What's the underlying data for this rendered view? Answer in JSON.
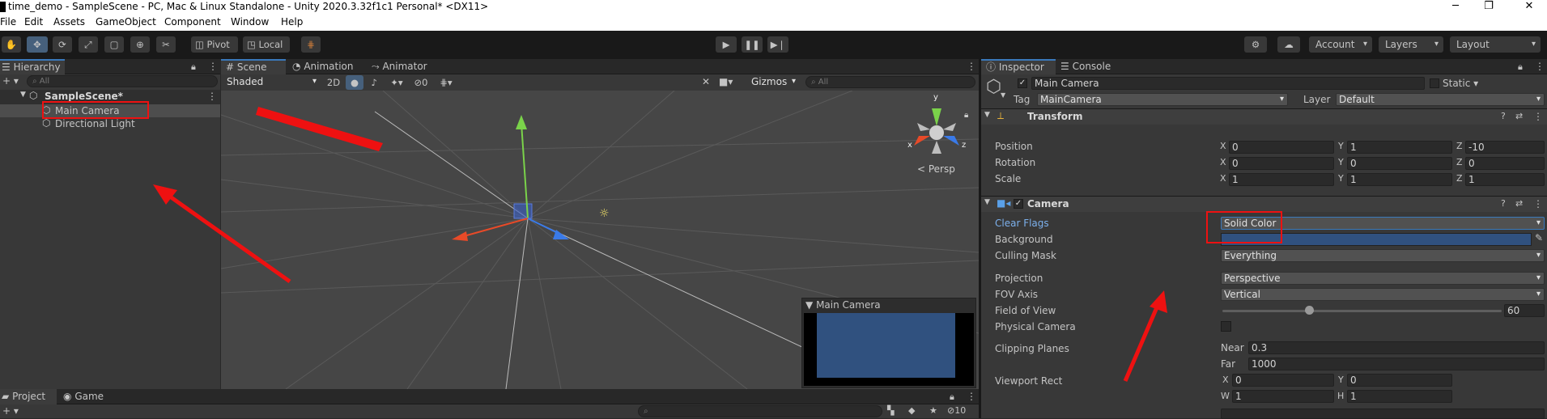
{
  "window": {
    "title": "time_demo - SampleScene - PC, Mac & Linux Standalone - Unity 2020.3.32f1c1 Personal* <DX11>",
    "minimize": "─",
    "maximize": "❐",
    "close": "✕"
  },
  "menu": [
    "File",
    "Edit",
    "Assets",
    "GameObject",
    "Component",
    "Window",
    "Help"
  ],
  "toolbar": {
    "pivot_label": "Pivot",
    "local_label": "Local",
    "account_label": "Account",
    "layers_label": "Layers",
    "layout_label": "Layout"
  },
  "hierarchy": {
    "tab_label": "Hierarchy",
    "add_label": "+ ▾",
    "search_placeholder": "All",
    "scene_name": "SampleScene*",
    "items": [
      "Main Camera",
      "Directional Light"
    ]
  },
  "scene_view": {
    "tabs": [
      "Scene",
      "Animation",
      "Animator"
    ],
    "shading_mode": "Shaded",
    "mode_2d": "2D",
    "hidden_count": "0",
    "gizmos_label": "Gizmos",
    "search_placeholder": "All",
    "persp_label": "< Persp",
    "axis_x": "x",
    "axis_y": "y",
    "axis_z": "z",
    "camera_preview_title": "Main Camera",
    "preview_color": "#30517f"
  },
  "bottom_panel": {
    "tabs": [
      "Project",
      "Game"
    ],
    "add_label": "+ ▾",
    "visible_count": "10"
  },
  "inspector": {
    "tabs": [
      "Inspector",
      "Console"
    ],
    "object_name": "Main Camera",
    "static_label": "Static",
    "tag_label": "Tag",
    "tag_value": "MainCamera",
    "layer_label": "Layer",
    "layer_value": "Default",
    "transform": {
      "title": "Transform",
      "rows": [
        {
          "label": "Position",
          "x": "0",
          "y": "1",
          "z": "-10"
        },
        {
          "label": "Rotation",
          "x": "0",
          "y": "0",
          "z": "0"
        },
        {
          "label": "Scale",
          "x": "1",
          "y": "1",
          "z": "1"
        }
      ]
    },
    "camera": {
      "title": "Camera",
      "clear_flags_label": "Clear Flags",
      "clear_flags_value": "Solid Color",
      "background_label": "Background",
      "background_color": "#30517f",
      "culling_mask_label": "Culling Mask",
      "culling_mask_value": "Everything",
      "projection_label": "Projection",
      "projection_value": "Perspective",
      "fov_axis_label": "FOV Axis",
      "fov_axis_value": "Vertical",
      "fov_label": "Field of View",
      "fov_value": "60",
      "fov_slider_fraction": 0.31,
      "physical_camera_label": "Physical Camera",
      "clipping_planes_label": "Clipping Planes",
      "near_label": "Near",
      "near_value": "0.3",
      "far_label": "Far",
      "far_value": "1000",
      "viewport_rect_label": "Viewport Rect",
      "vp_x": "0",
      "vp_y": "0",
      "vp_w": "1",
      "vp_h": "1"
    }
  },
  "colors": {
    "accent": "#3a79bb",
    "annotation": "#e11111"
  }
}
